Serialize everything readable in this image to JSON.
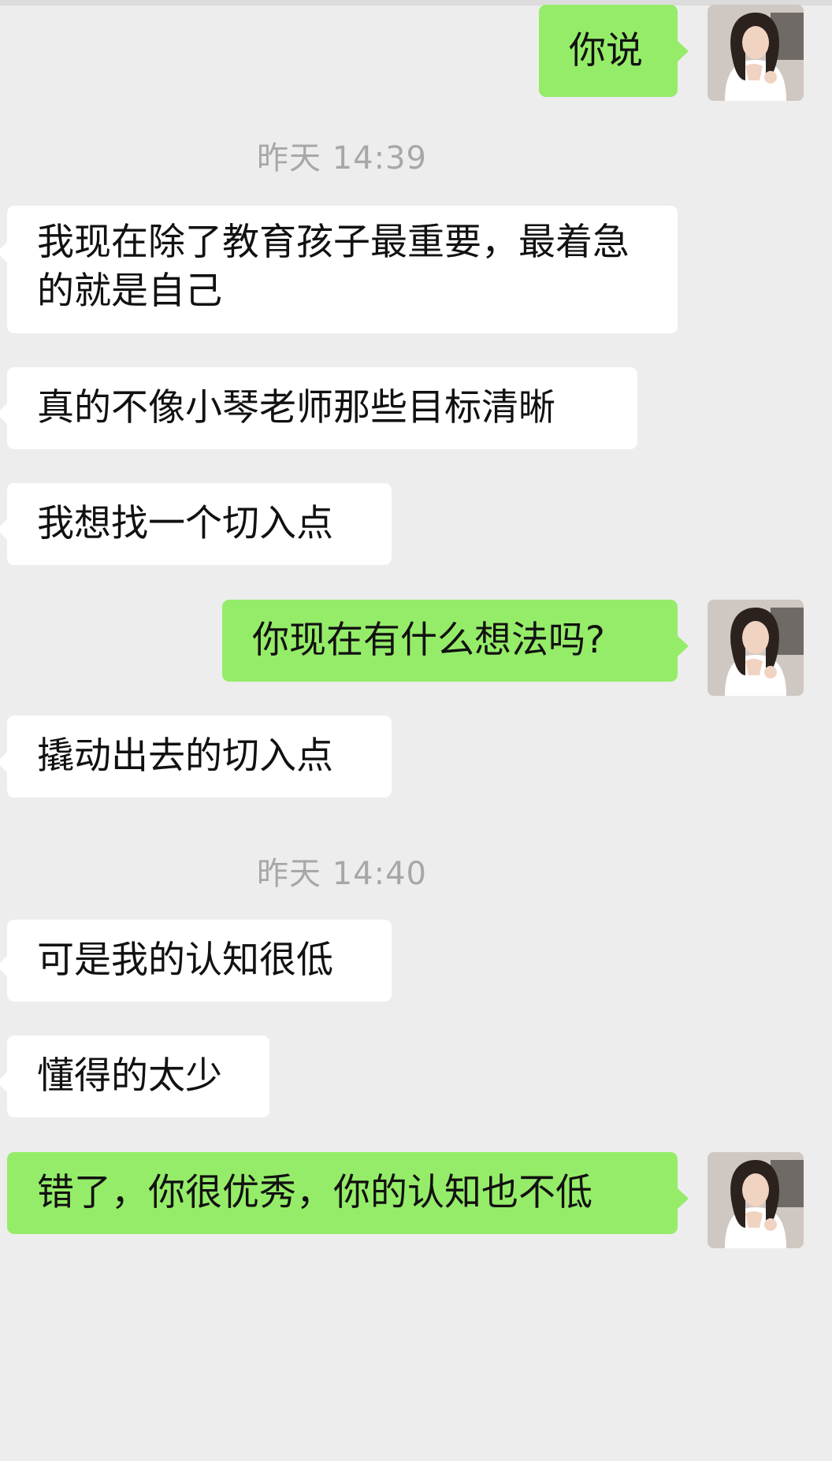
{
  "messages": [
    {
      "side": "out",
      "text": "你说"
    },
    {
      "type": "time",
      "text": "昨天 14:39"
    },
    {
      "side": "in",
      "text": "我现在除了教育孩子最重要，最着急的就是自己"
    },
    {
      "side": "in",
      "text": "真的不像小琴老师那些目标清晰"
    },
    {
      "side": "in",
      "text": "我想找一个切入点"
    },
    {
      "side": "out",
      "text": "你现在有什么想法吗?"
    },
    {
      "side": "in",
      "text": "撬动出去的切入点"
    },
    {
      "type": "time",
      "text": "昨天 14:40"
    },
    {
      "side": "in",
      "text": "可是我的认知很低"
    },
    {
      "side": "in",
      "text": "懂得的太少"
    },
    {
      "side": "out",
      "text": "错了，你很优秀，你的认知也不低"
    }
  ],
  "colors": {
    "background": "#ededed",
    "incoming_bubble": "#ffffff",
    "outgoing_bubble": "#95ec69",
    "timestamp_text": "#a7a7a7"
  },
  "avatar_icon": "user-avatar-photo"
}
